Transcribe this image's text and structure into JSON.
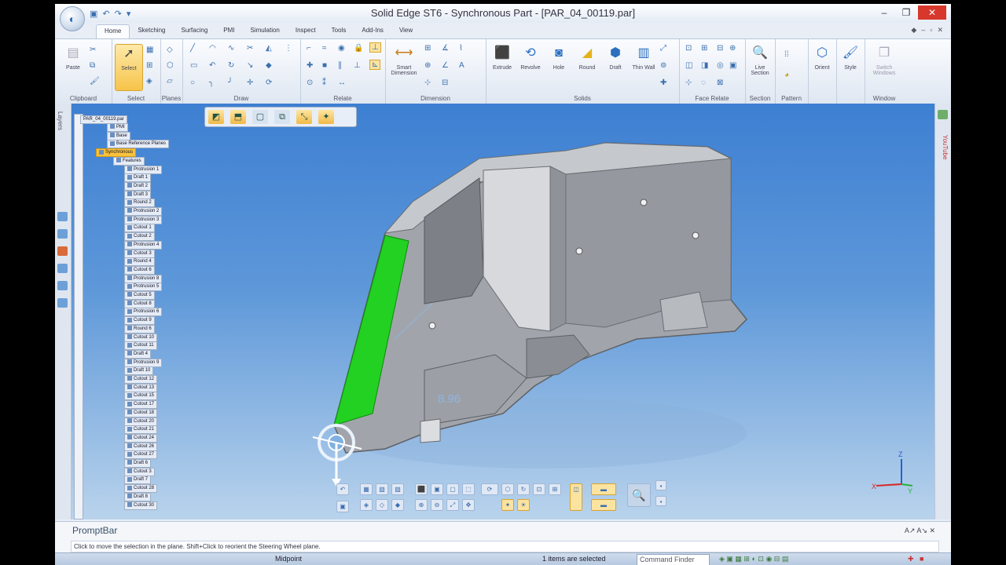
{
  "window": {
    "title": "Solid Edge ST6 - Synchronous Part - [PAR_04_00119.par]",
    "controls": {
      "minimize": "–",
      "maximize": "❐",
      "close": "✕"
    }
  },
  "tabs": [
    "Home",
    "Sketching",
    "Surfacing",
    "PMI",
    "Simulation",
    "Inspect",
    "Tools",
    "Add-Ins",
    "View"
  ],
  "active_tab": "Home",
  "ribbon": {
    "groups": {
      "clipboard": "Clipboard",
      "select": "Select",
      "planes": "Planes",
      "draw": "Draw",
      "relate": "Relate",
      "dimension": "Dimension",
      "solids": "Solids",
      "face_relate": "Face Relate",
      "section": "Section",
      "pattern": "Pattern",
      "window": "Window"
    },
    "buttons": {
      "paste": "Paste",
      "select": "Select",
      "smart_dimension": "Smart Dimension",
      "extrude": "Extrude",
      "revolve": "Revolve",
      "hole": "Hole",
      "round": "Round",
      "draft": "Draft",
      "thin_wall": "Thin Wall",
      "live_section": "Live Section",
      "orient": "Orient",
      "style": "Style",
      "switch_windows": "Switch Windows"
    }
  },
  "side_panels": {
    "layers": "Layers",
    "youtube": "YouTube"
  },
  "tree": {
    "root": "PAR_04_00119.par",
    "items": [
      {
        "label": "PMI",
        "indent": 1
      },
      {
        "label": "Base",
        "indent": 1
      },
      {
        "label": "Base Reference Planes",
        "indent": 1
      },
      {
        "label": "Synchronous",
        "indent": 0,
        "selected": true
      },
      {
        "label": "Features",
        "indent": 1
      },
      {
        "label": "Protrusion 1",
        "indent": 2
      },
      {
        "label": "Draft 1",
        "indent": 2
      },
      {
        "label": "Draft 2",
        "indent": 2
      },
      {
        "label": "Draft 3",
        "indent": 2
      },
      {
        "label": "Round 2",
        "indent": 2
      },
      {
        "label": "Protrusion 2",
        "indent": 2
      },
      {
        "label": "Protrusion 3",
        "indent": 2
      },
      {
        "label": "Cutout 1",
        "indent": 2
      },
      {
        "label": "Cutout 2",
        "indent": 2
      },
      {
        "label": "Protrusion 4",
        "indent": 2
      },
      {
        "label": "Cutout 3",
        "indent": 2
      },
      {
        "label": "Round 4",
        "indent": 2
      },
      {
        "label": "Cutout 6",
        "indent": 2
      },
      {
        "label": "Protrusion 8",
        "indent": 2
      },
      {
        "label": "Protrusion 5",
        "indent": 2
      },
      {
        "label": "Cutout 5",
        "indent": 2
      },
      {
        "label": "Cutout 8",
        "indent": 2
      },
      {
        "label": "Protrusion 6",
        "indent": 2
      },
      {
        "label": "Cutout 9",
        "indent": 2
      },
      {
        "label": "Round 6",
        "indent": 2
      },
      {
        "label": "Cutout 10",
        "indent": 2
      },
      {
        "label": "Cutout 11",
        "indent": 2
      },
      {
        "label": "Draft 4",
        "indent": 2
      },
      {
        "label": "Protrusion 9",
        "indent": 2
      },
      {
        "label": "Draft 10",
        "indent": 2
      },
      {
        "label": "Cutout 12",
        "indent": 2
      },
      {
        "label": "Cutout 13",
        "indent": 2
      },
      {
        "label": "Cutout 15",
        "indent": 2
      },
      {
        "label": "Cutout 17",
        "indent": 2
      },
      {
        "label": "Cutout 18",
        "indent": 2
      },
      {
        "label": "Cutout 20",
        "indent": 2
      },
      {
        "label": "Cutout 21",
        "indent": 2
      },
      {
        "label": "Cutout 24",
        "indent": 2
      },
      {
        "label": "Cutout 26",
        "indent": 2
      },
      {
        "label": "Cutout 27",
        "indent": 2
      },
      {
        "label": "Draft 6",
        "indent": 2
      },
      {
        "label": "Cutout 3",
        "indent": 2
      },
      {
        "label": "Draft 7",
        "indent": 2
      },
      {
        "label": "Cutout 28",
        "indent": 2
      },
      {
        "label": "Draft 8",
        "indent": 2
      },
      {
        "label": "Cutout 30",
        "indent": 2
      }
    ]
  },
  "viewport": {
    "dimension_value": "8.96",
    "axes": {
      "z": "Z",
      "x": "X",
      "y": "Y"
    },
    "colors": {
      "selected_face": "#22d122",
      "body": "#9a9ea4",
      "background_top": "#3d7fd2"
    }
  },
  "promptbar": {
    "title": "PromptBar",
    "message": "Click to move the selection in the plane.  Shift+Click to reorient the Steering Wheel plane.",
    "controls": "A↗ A↘ ✕"
  },
  "status": {
    "left": "Midpoint",
    "selection": "1 items are selected",
    "command_finder": "Command Finder"
  }
}
